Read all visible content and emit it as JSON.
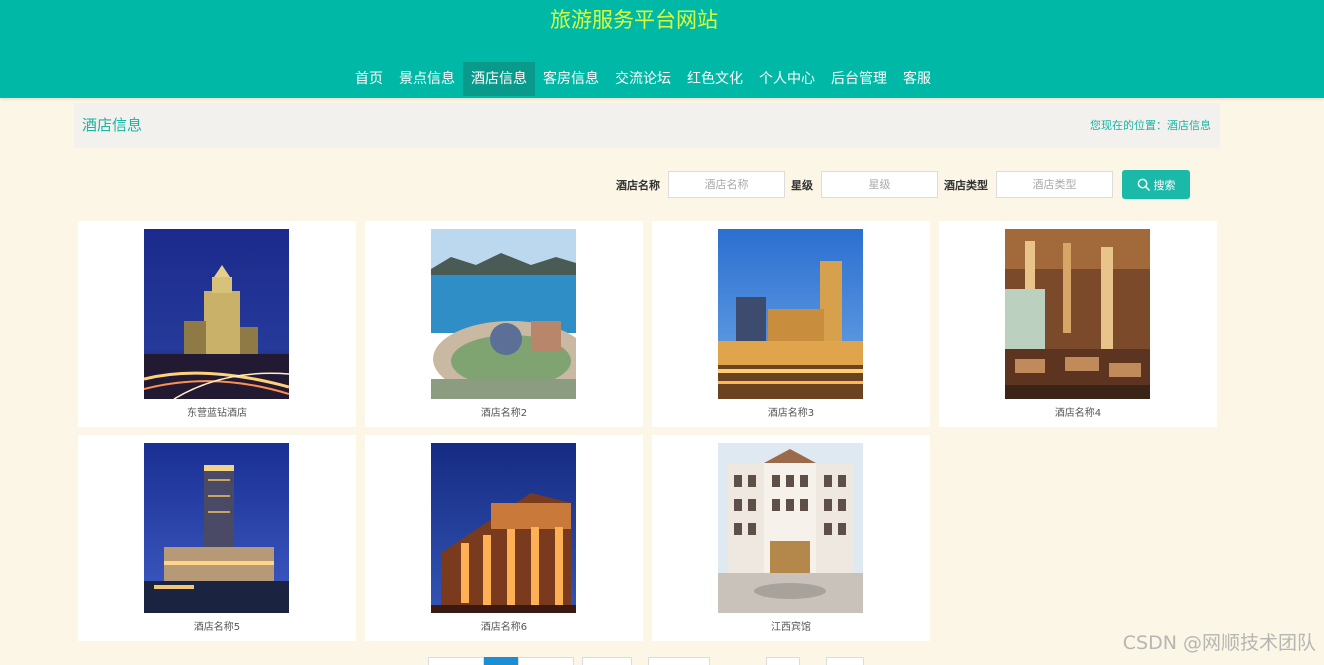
{
  "site": {
    "title": "旅游服务平台网站"
  },
  "nav": {
    "items": [
      {
        "label": "首页"
      },
      {
        "label": "景点信息"
      },
      {
        "label": "酒店信息"
      },
      {
        "label": "客房信息"
      },
      {
        "label": "交流论坛"
      },
      {
        "label": "红色文化"
      },
      {
        "label": "个人中心"
      },
      {
        "label": "后台管理"
      },
      {
        "label": "客服"
      }
    ],
    "active_index": 2
  },
  "page_bar": {
    "title": "酒店信息",
    "breadcrumb": "您现在的位置：酒店信息"
  },
  "search": {
    "name_label": "酒店名称",
    "name_placeholder": "酒店名称",
    "star_label": "星级",
    "star_placeholder": "星级",
    "type_label": "酒店类型",
    "type_placeholder": "酒店类型",
    "button_label": "搜索"
  },
  "hotels": [
    {
      "name": "东营蓝钻酒店",
      "image": "night-tower-hotel"
    },
    {
      "name": "酒店名称2",
      "image": "seaside-dome-hotel"
    },
    {
      "name": "酒店名称3",
      "image": "golden-resort-hotel"
    },
    {
      "name": "酒店名称4",
      "image": "grand-lobby-interior"
    },
    {
      "name": "酒店名称5",
      "image": "tall-tower-night-hotel"
    },
    {
      "name": "酒店名称6",
      "image": "lit-colonnade-building"
    },
    {
      "name": "江西宾馆",
      "image": "classical-white-hotel"
    }
  ],
  "pagination": {
    "active_page": 2
  },
  "watermark": "CSDN @网顺技术团队",
  "colors": {
    "header_bg": "#00b8a6",
    "nav_active_bg": "#0a9a8b",
    "site_title": "#d9ff3a",
    "accent": "#18b4a4",
    "page_bg": "#fbf6e5"
  }
}
